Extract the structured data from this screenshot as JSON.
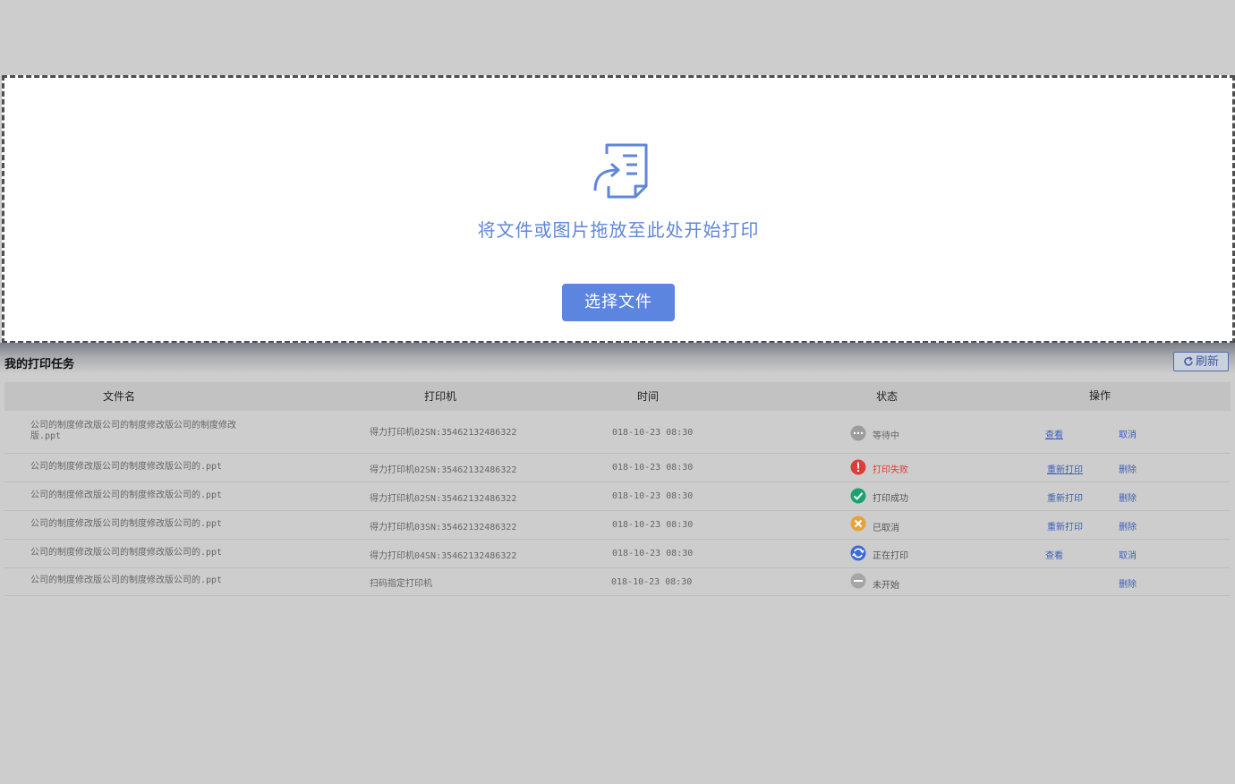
{
  "dropzone": {
    "hint": "将文件或图片拖放至此处开始打印",
    "select_button": "选择文件"
  },
  "tasks": {
    "title": "我的打印任务",
    "refresh_label": "刷新",
    "columns": [
      "文件名",
      "打印机",
      "时间",
      "状态",
      "操作"
    ],
    "rows": [
      {
        "file": "公司的制度修改版公司的制度修改版公司的制度修改版.ppt",
        "printer": "得力打印机02SN:35462132486322",
        "time": "018-10-23  08:30",
        "status": "等待中",
        "status_icon": "more-icon",
        "status_color": "#999999",
        "actions": [
          "查看",
          "取消"
        ]
      },
      {
        "file": "公司的制度修改版公司的制度修改版公司的.ppt",
        "printer": "得力打印机02SN:35462132486322",
        "time": "018-10-23  08:30",
        "status": "打印失败",
        "status_icon": "error-icon",
        "status_color": "#e03b3b",
        "actions": [
          "重新打印",
          "删除"
        ]
      },
      {
        "file": "公司的制度修改版公司的制度修改版公司的.ppt",
        "printer": "得力打印机02SN:35462132486322",
        "time": "018-10-23  08:30",
        "status": "打印成功",
        "status_icon": "check-icon",
        "status_color": "#1aa36f",
        "actions": [
          "重新打印",
          "删除"
        ]
      },
      {
        "file": "公司的制度修改版公司的制度修改版公司的.ppt",
        "printer": "得力打印机03SN:35462132486322",
        "time": "018-10-23  08:30",
        "status": "已取消",
        "status_icon": "cancel-icon",
        "status_color": "#e8a23a",
        "actions": [
          "重新打印",
          "删除"
        ]
      },
      {
        "file": "公司的制度修改版公司的制度修改版公司的.ppt",
        "printer": "得力打印机04SN:35462132486322",
        "time": "018-10-23  08:30",
        "status": "正在打印",
        "status_icon": "sync-icon",
        "status_color": "#3b6bd6",
        "actions": [
          "查看",
          "取消"
        ]
      },
      {
        "file": "公司的制度修改版公司的制度修改版公司的.ppt",
        "printer": "扫码指定打印机",
        "time": "018-10-23  08:30",
        "status": "未开始",
        "status_icon": "minus-icon",
        "status_color": "#a6a6a6",
        "actions": [
          "删除"
        ]
      }
    ]
  }
}
